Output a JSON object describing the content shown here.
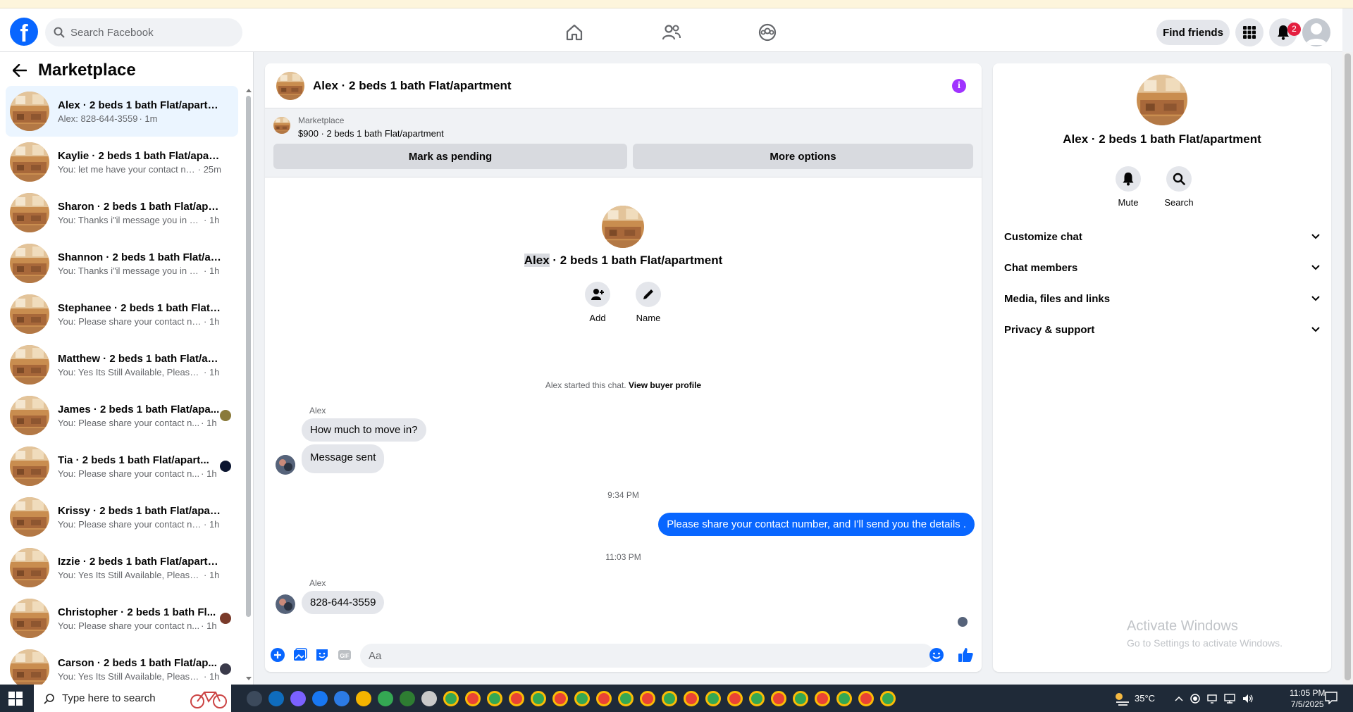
{
  "nav": {
    "search_placeholder": "Search Facebook",
    "find_friends": "Find friends",
    "notification_count": "2"
  },
  "sidebar": {
    "title": "Marketplace",
    "conversations": [
      {
        "title": "Alex · 2 beds 1 bath Flat/apartm...",
        "message": "Alex: 828-644-3559",
        "time": "· 1m",
        "active": true
      },
      {
        "title": "Kaylie · 2 beds 1 bath Flat/apart...",
        "message": "You: let me have your contact nu...",
        "time": "· 25m"
      },
      {
        "title": "Sharon · 2 beds 1 bath Flat/apart...",
        "message": "You: Thanks i\"il message you in a ...",
        "time": "· 1h"
      },
      {
        "title": "Shannon · 2 beds 1 bath Flat/ap...",
        "message": "You: Thanks i\"il message you in a ...",
        "time": "· 1h"
      },
      {
        "title": "Stephanee · 2 beds 1 bath Flat/a...",
        "message": "You: Please share your contact num...",
        "time": "· 1h"
      },
      {
        "title": "Matthew · 2 beds 1 bath Flat/ap...",
        "message": "You: Yes Its Still Available, Please Se...",
        "time": "· 1h"
      },
      {
        "title": "James · 2 beds 1 bath Flat/apa...",
        "message": "You: Please share your contact n...",
        "time": "· 1h",
        "read": "#8a7a3a"
      },
      {
        "title": "Tia · 2 beds 1 bath Flat/apart...",
        "message": "You: Please share your contact n...",
        "time": "· 1h",
        "read": "#0b1530"
      },
      {
        "title": "Krissy · 2 beds 1 bath Flat/apart...",
        "message": "You: Please share your contact num...",
        "time": "· 1h"
      },
      {
        "title": "Izzie · 2 beds 1 bath Flat/apartm...",
        "message": "You: Yes Its Still Available, Please Se...",
        "time": "· 1h"
      },
      {
        "title": "Christopher · 2 beds 1 bath Fl...",
        "message": "You: Please share your contact n...",
        "time": "· 1h",
        "read": "#7a3a2a"
      },
      {
        "title": "Carson · 2 beds 1 bath Flat/ap...",
        "message": "You: Yes Its Still Available, Please ...",
        "time": "· 1h",
        "read": "#3a3a4a"
      }
    ]
  },
  "chat": {
    "header_title": "Alex · 2 beds 1 bath Flat/apartment",
    "banner_label": "Marketplace",
    "banner_price": "$900 · 2 beds 1 bath Flat/apartment",
    "mark_pending": "Mark as pending",
    "more_options": "More options",
    "center_name_first": "Alex",
    "center_name_rest": " · 2 beds 1 bath Flat/apartment",
    "add_label": "Add",
    "name_label": "Name",
    "started_text": "Alex started this chat. ",
    "view_buyer": "View buyer profile",
    "sender_1": "Alex",
    "msg_1": "How much to move in?",
    "msg_2": "Message sent",
    "time_1": "9:34 PM",
    "msg_out": "Please share your contact number, and I'll send you the details .",
    "time_2": "11:03 PM",
    "sender_2": "Alex",
    "msg_3": "828-644-3559",
    "composer_placeholder": "Aa"
  },
  "right": {
    "name": "Alex · 2 beds 1 bath Flat/apartment",
    "mute": "Mute",
    "search": "Search",
    "sections": [
      "Customize chat",
      "Chat members",
      "Media, files and links",
      "Privacy & support"
    ],
    "watermark_1": "Activate Windows",
    "watermark_2": "Go to Settings to activate Windows."
  },
  "taskbar": {
    "search_placeholder": "Type here to search",
    "temperature": "35°C",
    "time": "11:05 PM",
    "date": "7/5/2025"
  },
  "colors": {
    "brand": "#0866ff",
    "accent_purple": "#a033ff",
    "badge_red": "#e41e3f"
  }
}
